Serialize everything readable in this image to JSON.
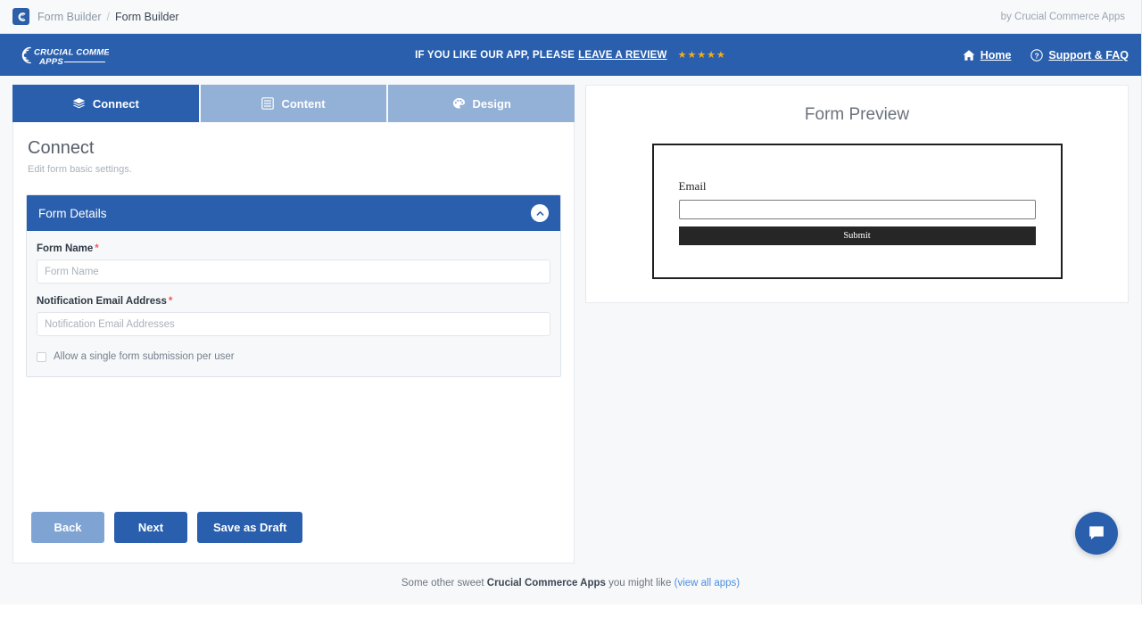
{
  "topbar": {
    "logo_icon": "crucial-c-logo-icon",
    "breadcrumb_root": "Form Builder",
    "breadcrumb_sep": "/",
    "breadcrumb_current": "Form Builder",
    "attribution": "by Crucial Commerce Apps"
  },
  "navbar": {
    "logo_line1": "CRUCIAL COMMERCE",
    "logo_line2": "APPS",
    "review_text": "IF YOU LIKE OUR APP, PLEASE",
    "review_link": "LEAVE A REVIEW",
    "stars": "★★★★★",
    "star_count": 5,
    "star_color": "#f0ad21",
    "home_label": "Home",
    "home_icon": "home-icon",
    "support_label": "Support & FAQ",
    "support_icon": "question-circle-icon",
    "background": "#2a5fad"
  },
  "tabs": [
    {
      "label": "Connect",
      "icon": "layers-icon",
      "active": true
    },
    {
      "label": "Content",
      "icon": "list-document-icon",
      "active": false
    },
    {
      "label": "Design",
      "icon": "palette-icon",
      "active": false
    }
  ],
  "connect": {
    "title": "Connect",
    "subtitle": "Edit form basic settings.",
    "panel": {
      "title": "Form Details",
      "collapse_icon": "chevron-up-icon",
      "fields": [
        {
          "label": "Form Name",
          "required_mark": "*",
          "value": "",
          "placeholder": "Form Name"
        },
        {
          "label": "Notification Email Address",
          "required_mark": "*",
          "value": "",
          "placeholder": "Notification Email Addresses"
        }
      ],
      "checkbox": {
        "label": "Allow a single form submission per user",
        "checked": false
      }
    },
    "buttons": {
      "back": "Back",
      "next": "Next",
      "save_draft": "Save as Draft"
    }
  },
  "preview": {
    "title": "Form Preview",
    "field_label": "Email",
    "field_value": "",
    "submit_label": "Submit"
  },
  "footer": {
    "text_before": "Some other sweet ",
    "brand": "Crucial Commerce Apps",
    "text_after": " you might like ",
    "link": "(view all apps)"
  },
  "chat": {
    "icon": "chat-bubble-icon",
    "color": "#2a5fad"
  }
}
